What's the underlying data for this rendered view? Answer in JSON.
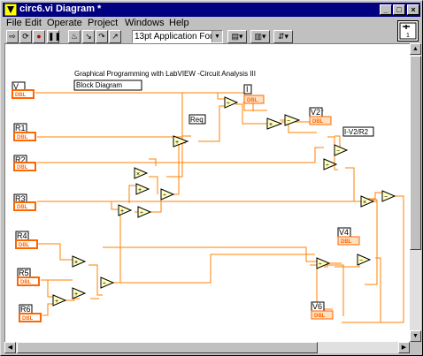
{
  "window": {
    "title": "circ6.vi Diagram *"
  },
  "menu": [
    "File",
    "Edit",
    "Operate",
    "Project",
    "Windows",
    "Help"
  ],
  "toolbar": {
    "font": "13pt Application Font",
    "icons": [
      "run-arrow-icon",
      "run-continuous-icon",
      "abort-icon",
      "pause-icon",
      "highlight-bulb-icon",
      "step-into-icon",
      "step-over-icon",
      "step-out-icon",
      "align-icon",
      "distribute-icon",
      "reorder-icon"
    ]
  },
  "connector_pane_label": "1",
  "diagram": {
    "title": "Graphical Programming with LabVIEW -Circuit Analysis III",
    "subtitle": "Block Diagram",
    "controls": [
      "V",
      "R1",
      "R2",
      "R3",
      "R4",
      "R5",
      "R6"
    ],
    "indicators": [
      "I",
      "V2",
      "I-V2/R2",
      "V4",
      "V6"
    ],
    "extra_label": "Req",
    "terminal_type": "DBL",
    "wire_color": "#ff8000"
  }
}
